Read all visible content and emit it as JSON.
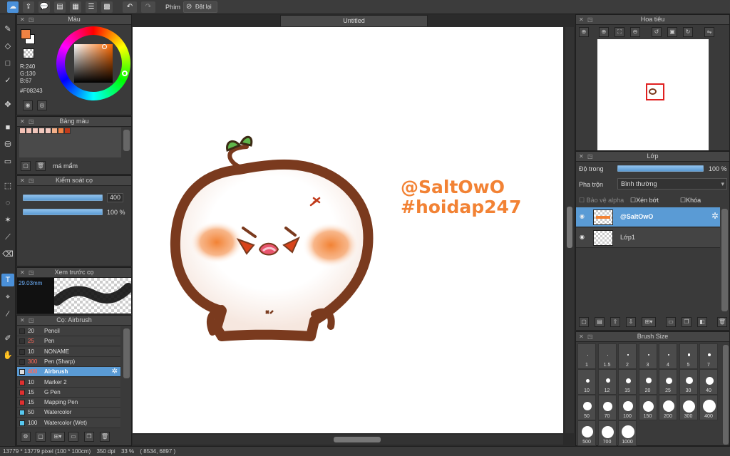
{
  "toolbar": {
    "shortcut_label": "Phím",
    "reset_label": "Đặt lại"
  },
  "document": {
    "title": "Untitled"
  },
  "color_panel": {
    "title": "Màu",
    "r": "R:240",
    "g": "G:130",
    "b": "B:67",
    "hex": "#F08243",
    "main_color": "#f08243",
    "sub_color": "#ffffff"
  },
  "swatch_panel": {
    "title": "Bảng màu",
    "name": "má mẩm",
    "swatches": [
      "#f3c1b5",
      "#f2c3b8",
      "#f0c6bb",
      "#f1c8bd",
      "#f4c9c0",
      "#f3b08a",
      "#f08243",
      "#c03a1a"
    ]
  },
  "brush_control": {
    "title": "Kiểm soát cọ",
    "size_value": "400",
    "opacity_value": "100 %",
    "size_level": 1.0,
    "opacity_level": 1.0
  },
  "brush_preview": {
    "title": "Xem trước cọ",
    "size_text": "29.03mm"
  },
  "brush_list": {
    "title": "Cọ: Airbrush",
    "items": [
      {
        "size": "20",
        "name": "Pencil",
        "color": "#333333",
        "red": false
      },
      {
        "size": "25",
        "name": "Pen",
        "color": "#333333",
        "red": true
      },
      {
        "size": "10",
        "name": "NONAME",
        "color": "#333333",
        "red": false
      },
      {
        "size": "300",
        "name": "Pen (Sharp)",
        "color": "#333333",
        "red": true
      },
      {
        "size": "400",
        "name": "Airbrush",
        "color": "#dddddd",
        "red": true
      },
      {
        "size": "10",
        "name": "Marker 2",
        "color": "#e03030",
        "red": false
      },
      {
        "size": "15",
        "name": "G Pen",
        "color": "#e03030",
        "red": false
      },
      {
        "size": "15",
        "name": "Mapping Pen",
        "color": "#e03030",
        "red": false
      },
      {
        "size": "50",
        "name": "Watercolor",
        "color": "#58c8f0",
        "red": false
      },
      {
        "size": "100",
        "name": "Watercolor (Wet)",
        "color": "#58c8f0",
        "red": false
      }
    ],
    "selected_index": 4
  },
  "canvas": {
    "watermark_line1": "@SaltOwO",
    "watermark_line2": "#hoidap247",
    "accent": "#f28234",
    "outline": "#7a3a1e"
  },
  "navigator": {
    "title": "Hoa tiêu"
  },
  "layers": {
    "title": "Lớp",
    "opacity_label": "Độ trong",
    "opacity_value": "100 %",
    "opacity_level": 1.0,
    "blend_label": "Pha trộn",
    "blend_value": "Bình thường",
    "protect_alpha": "Bảo vệ alpha",
    "clip": "Xén bớt",
    "lock": "Khóa",
    "items": [
      {
        "name": "@SaltOwO",
        "selected": true
      },
      {
        "name": "Lớp1",
        "selected": false
      }
    ]
  },
  "brush_size": {
    "title": "Brush Size",
    "sizes": [
      "1",
      "1.5",
      "2",
      "3",
      "4",
      "5",
      "7",
      "10",
      "12",
      "15",
      "20",
      "25",
      "30",
      "40",
      "50",
      "70",
      "100",
      "150",
      "200",
      "300",
      "400",
      "500",
      "700",
      "1000"
    ]
  },
  "status": {
    "dimensions": "13779 * 13779 pixel",
    "physical": "(100 * 100cm)",
    "dpi": "350 dpi",
    "zoom": "33 %",
    "coords": "( 8534, 6897 )"
  }
}
